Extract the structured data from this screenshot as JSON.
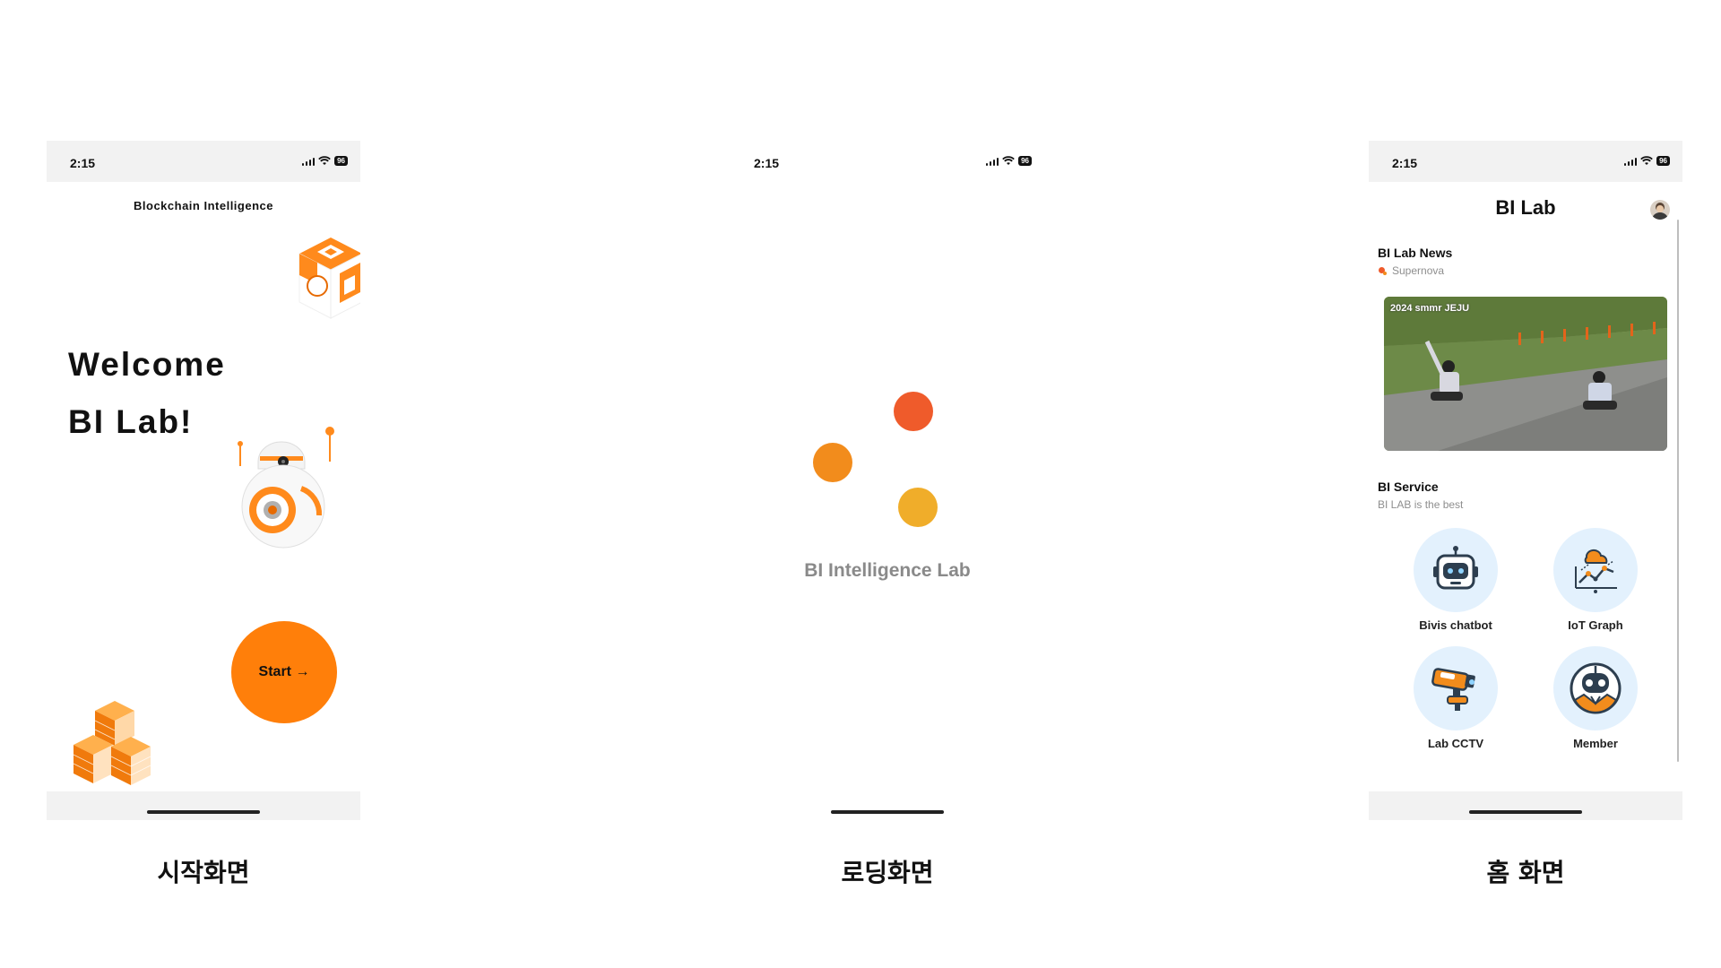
{
  "statusbar": {
    "time": "2:15",
    "battery": "96"
  },
  "start_screen": {
    "header": "Blockchain Intelligence",
    "welcome_line1": "Welcome",
    "welcome_line2": "BI Lab!",
    "start_label": "Start →",
    "caption": "시작화면"
  },
  "loading_screen": {
    "title": "BI Intelligence Lab",
    "caption": "로딩화면"
  },
  "home_screen": {
    "title": "BI Lab",
    "news_title": "BI Lab News",
    "news_sub": "Supernova",
    "news_image_caption": "2024 smmr JEJU",
    "service_title": "BI Service",
    "service_sub": "BI LAB is the best",
    "services": [
      {
        "label": "Bivis chatbot",
        "icon": "robot-chatbot-icon"
      },
      {
        "label": "IoT Graph",
        "icon": "iot-graph-icon"
      },
      {
        "label": "Lab CCTV",
        "icon": "cctv-camera-icon"
      },
      {
        "label": "Member",
        "icon": "member-robot-icon"
      }
    ],
    "caption": "홈 화면"
  },
  "colors": {
    "accent": "#ff7f0a",
    "dot_red": "#ef5b2b",
    "dot_orange": "#f28c1c",
    "dot_yellow": "#f0ad2a",
    "service_bg": "#e3f1fd",
    "muted": "#8a8a8a"
  }
}
